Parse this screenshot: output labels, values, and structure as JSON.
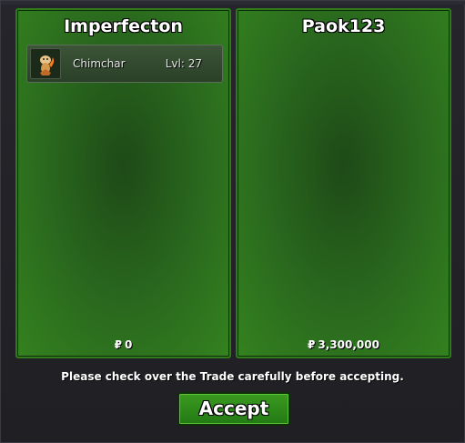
{
  "trade": {
    "left": {
      "player": "Imperfecton",
      "items": [
        {
          "icon": "chimchar-icon",
          "name": "Chimchar",
          "level": "Lvl: 27"
        }
      ],
      "money_symbol": "₽",
      "money": "0"
    },
    "right": {
      "player": "Paok123",
      "items": [],
      "money_symbol": "₽",
      "money": "3,300,000"
    },
    "notice": "Please check over the Trade carefully before accepting.",
    "accept_label": "Accept"
  },
  "colors": {
    "panel_green": "#2a6a1e",
    "panel_border": "#2f7a1a",
    "accept_green": "#2f8a1a",
    "window_bg": "#1f1f24"
  }
}
